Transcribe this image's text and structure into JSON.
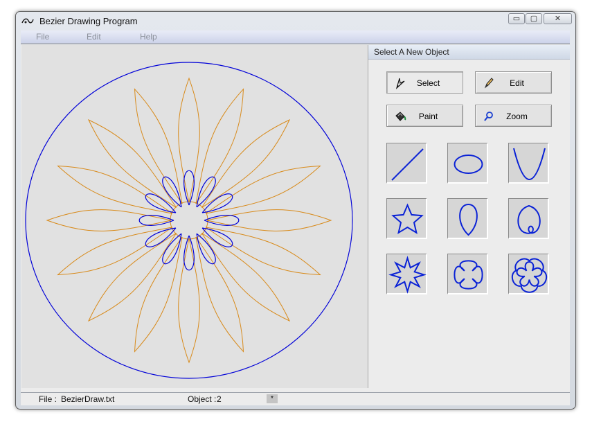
{
  "window": {
    "title": "Bezier Drawing Program"
  },
  "window_controls": {
    "minimize": "▭",
    "maximize": "▢",
    "close": "✕"
  },
  "menu": {
    "items": [
      "File",
      "Edit",
      "Help"
    ]
  },
  "panel": {
    "header": "Select A New Object",
    "tools": [
      {
        "label": "Select",
        "icon": "select-arrow-icon",
        "active": true
      },
      {
        "label": "Edit",
        "icon": "pencil-icon",
        "active": false
      },
      {
        "label": "Paint",
        "icon": "paint-bucket-icon",
        "active": false
      },
      {
        "label": "Zoom",
        "icon": "magnifier-icon",
        "active": false
      }
    ],
    "shapes": [
      "line",
      "ellipse",
      "parabola",
      "star",
      "teardrop",
      "loop",
      "spiked-star",
      "four-loop-star",
      "five-loop-rosette"
    ]
  },
  "status": {
    "file_label": "File :",
    "file_name": "BezierDraw.txt",
    "object_label": "Object :",
    "object_value": "2",
    "modified_marker": "*"
  },
  "colors": {
    "circle": "#0000d8",
    "petals": "#d88a1a",
    "loops": "#0000d8",
    "shape_stroke": "#0a22d6"
  }
}
